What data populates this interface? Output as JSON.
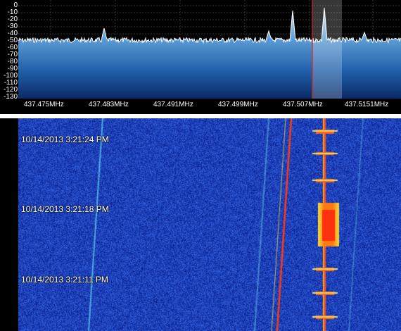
{
  "spectrum": {
    "db_scale": [
      "0",
      "-10",
      "-20",
      "-30",
      "-40",
      "-50",
      "-60",
      "-70",
      "-80",
      "-90",
      "-100",
      "-110",
      "-120",
      "-130"
    ],
    "frequency_labels": [
      "437.475MHz",
      "437.483MHz",
      "437.491MHz",
      "437.499MHz",
      "437.507MHz",
      "437.5151MHz"
    ],
    "colors": {
      "trace": "#ffffff",
      "fill_top": "#cfe3f4",
      "fill_mid": "#2f7fc8",
      "fill_bottom": "#0a2a66",
      "grid": "#555555",
      "tuning_line": "#e02020",
      "passband": "#ffffff"
    }
  },
  "waterfall": {
    "timestamps": [
      "10/14/2013 3:21:24 PM",
      "10/14/2013 3:21:18 PM",
      "10/14/2013 3:21:11 PM"
    ],
    "colors": {
      "background": "#1c2fa8",
      "signal_hot": "#ff3010",
      "signal_warm": "#ffd020",
      "signal_cool": "#40e0e0"
    }
  }
}
